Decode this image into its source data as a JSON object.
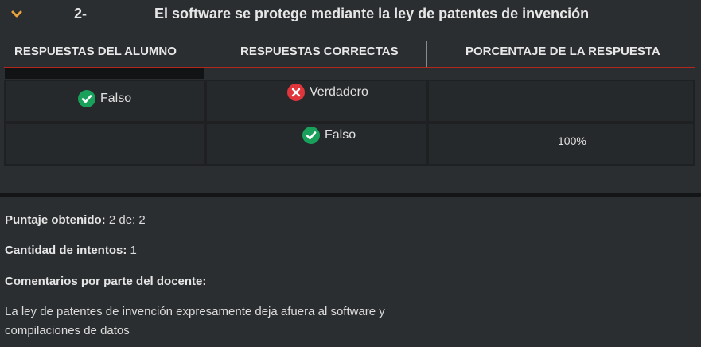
{
  "question": {
    "number": "2-",
    "title": "El software se protege mediante la ley de patentes de invención"
  },
  "table": {
    "headers": [
      "RESPUESTAS DEL ALUMNO",
      "RESPUESTAS CORRECTAS",
      "PORCENTAJE DE LA RESPUESTA"
    ],
    "rows": [
      {
        "alumno": "Falso",
        "correcta": "Verdadero",
        "porcentaje": ""
      },
      {
        "alumno": "",
        "correcta": "Falso",
        "porcentaje": "100%"
      }
    ]
  },
  "summary": {
    "puntaje_label": "Puntaje obtenido:",
    "puntaje_value": "2 de: 2",
    "intentos_label": "Cantidad de intentos:",
    "intentos_value": "1",
    "comentarios_label": "Comentarios por parte del docente:",
    "comentario": "La ley de patentes de invención expresamente deja afuera al software y compilaciones de datos"
  },
  "icons": {
    "expand": "chevron-down-icon",
    "correct": "check-circle-icon",
    "wrong": "x-circle-icon"
  },
  "colors": {
    "accent": "#e8a33d",
    "correct": "#19a15b",
    "wrong": "#e0353b",
    "header_line": "#b3261e"
  }
}
